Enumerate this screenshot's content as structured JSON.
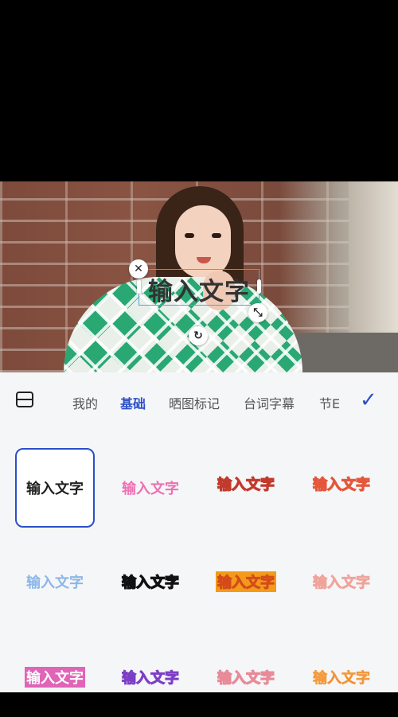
{
  "editor": {
    "text_box": {
      "text": "输入文字",
      "close_icon": "close-icon",
      "resize_icon": "resize-icon",
      "rotate_icon": "rotate-icon"
    }
  },
  "panel": {
    "keyboard_icon": "keyboard-icon",
    "tabs": [
      {
        "label": "我的"
      },
      {
        "label": "基础"
      },
      {
        "label": "晒图标记"
      },
      {
        "label": "台词字幕"
      },
      {
        "label": "节E"
      }
    ],
    "active_tab": "基础",
    "confirm_icon": "checkmark-icon",
    "styles": [
      {
        "label": "输入文字"
      },
      {
        "label": "输入文字"
      },
      {
        "label": "输入文字"
      },
      {
        "label": "输入文字"
      },
      {
        "label": "输入文字"
      },
      {
        "label": "输入文字"
      },
      {
        "label": "输入文字"
      },
      {
        "label": "输入文字"
      },
      {
        "label": "输入文字"
      },
      {
        "label": "输入文字"
      },
      {
        "label": "输入文字"
      },
      {
        "label": "输入文字"
      }
    ]
  },
  "colors": {
    "accent": "#2c4fc7",
    "panel_bg": "#f5f6f8"
  }
}
